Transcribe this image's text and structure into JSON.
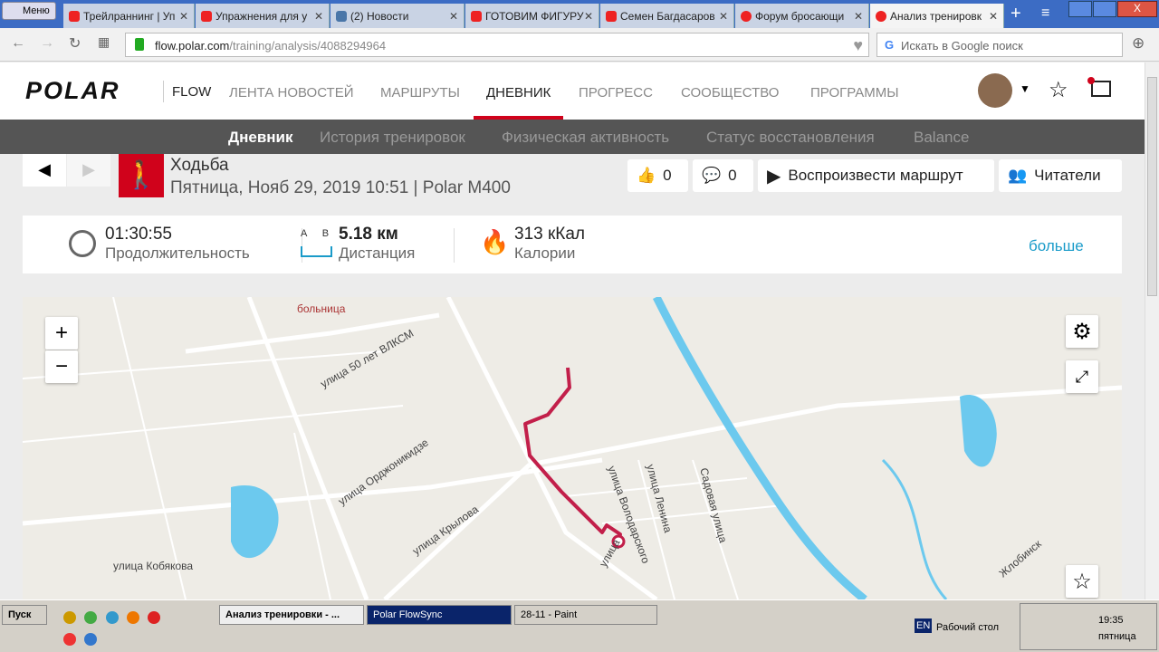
{
  "browser": {
    "menu": "Меню",
    "tabs": [
      "Трейлраннинг | Уп",
      "Упражнения для у",
      "(2) Новости",
      "ГОТОВИМ ФИГУРУ",
      "Семен Багдасаров",
      "Форум бросающи",
      "Анализ тренировк"
    ],
    "url_host": "flow.polar.com",
    "url_path": "/training/analysis/4088294964",
    "url_prefix": "",
    "search_placeholder": "Искать в Google поиск"
  },
  "header": {
    "logo": "POLAR",
    "flow": "FLOW",
    "nav": [
      "ЛЕНТА НОВОСТЕЙ",
      "МАРШРУТЫ",
      "ДНЕВНИК",
      "ПРОГРЕСС",
      "СООБЩЕСТВО",
      "ПРОГРАММЫ"
    ]
  },
  "subnav": [
    "Дневник",
    "История тренировок",
    "Физическая активность",
    "Статус восстановления",
    "Balance"
  ],
  "activity": {
    "sport": "Ходьба",
    "subtitle": "Пятница, Нояб 29, 2019 10:51 | Polar M400",
    "likes": "0",
    "comments": "0",
    "replay": "Воспроизвести маршрут",
    "followers": "Читатели"
  },
  "stats": {
    "duration": "01:30:55",
    "duration_label": "Продолжительность",
    "ab_a": "A",
    "ab_b": "B",
    "distance": "5.18 км",
    "distance_label": "Дистанция",
    "calories": "313 кКал",
    "calories_label": "Калории",
    "more": "больше"
  },
  "map": {
    "labels": [
      "больница",
      "улица 50 лет ВЛКСМ",
      "улица Орджоникидзе",
      "улица Крылова",
      "улица Кобякова",
      "улица Володарского",
      "улица Ленина",
      "Садовая улица",
      "улица",
      "Жлобинск"
    ],
    "zoom_in": "+",
    "zoom_out": "−"
  },
  "taskbar": {
    "start": "Пуск",
    "items": [
      "Анализ тренировки - ...",
      "Polar FlowSync",
      "28-11 - Paint"
    ],
    "lang": "EN",
    "desktop": "Рабочий стол",
    "time": "19:35",
    "day": "пятница"
  },
  "colors": {
    "route": "#c21f4a",
    "polar_red": "#d0021b",
    "link": "#1a9bc9"
  }
}
